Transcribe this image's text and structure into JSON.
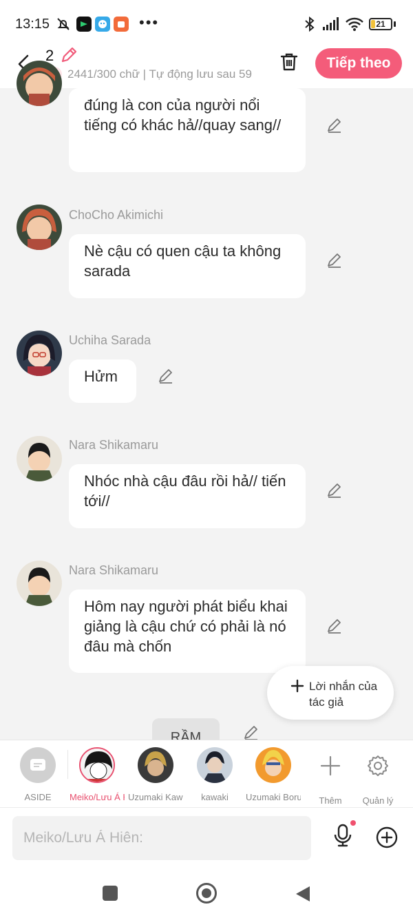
{
  "status_bar": {
    "time": "13:15",
    "battery": "21",
    "battery_level": 0.21
  },
  "header": {
    "chapter_number": "2",
    "word_count": "2441/300 chữ | Tự động lưu sau 59",
    "next_label": "Tiếp theo"
  },
  "messages": [
    {
      "author": "",
      "text": "đúng là con của người nổi tiếng có khác hả//quay sang//"
    },
    {
      "author": "ChoCho Akimichi",
      "text": "Nè cậu có quen cậu ta không sarada"
    },
    {
      "author": "Uchiha Sarada",
      "text": "Hửm"
    },
    {
      "author": "Nara Shikamaru",
      "text": "Nhóc nhà cậu đâu rồi hả// tiến tới//"
    },
    {
      "author": "Nara Shikamaru",
      "text": "Hôm nay người phát biểu khai giảng là cậu chứ có phải là nó đâu mà chốn"
    }
  ],
  "author_note": {
    "label": "Lời nhắn của tác giả"
  },
  "narration": {
    "text": "RẦM"
  },
  "characters": [
    {
      "label": "ASIDE"
    },
    {
      "label": "Meiko/Lưu Á Hiên"
    },
    {
      "label": "Uzumaki Kawaki"
    },
    {
      "label": "kawaki"
    },
    {
      "label": "Uzumaki Boruto"
    },
    {
      "label": "Thêm"
    },
    {
      "label": "Quản lý"
    }
  ],
  "input": {
    "placeholder": "Meiko/Lưu Á Hiên:"
  },
  "colors": {
    "accent": "#f45c7a",
    "background": "#f3f3f3",
    "bubble": "#ffffff"
  }
}
